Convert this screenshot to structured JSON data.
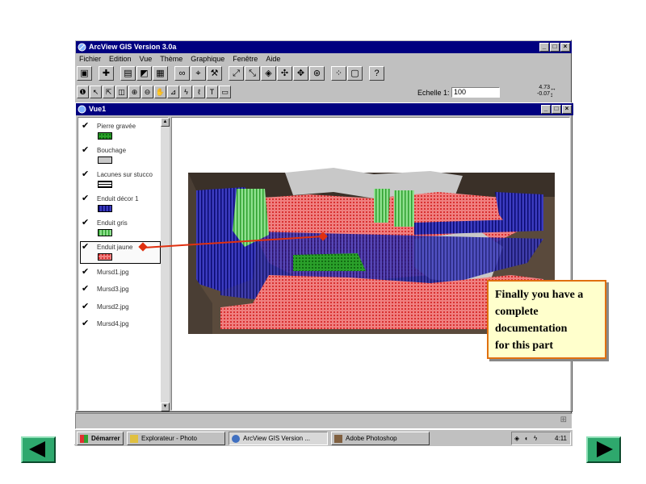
{
  "app": {
    "title": "ArcView GIS Version 3.0a",
    "menu": [
      "Fichier",
      "Edition",
      "Vue",
      "Thème",
      "Graphique",
      "Fenêtre",
      "Aide"
    ],
    "scale_label": "Echelle 1:",
    "scale_value": "100",
    "coords": [
      "4.73",
      "-0.07"
    ]
  },
  "view": {
    "title": "Vue1",
    "layers": [
      {
        "name": "Pierre gravée",
        "checked": true,
        "pattern": "green-dots"
      },
      {
        "name": "Bouchage",
        "checked": true,
        "pattern": "gray"
      },
      {
        "name": "Lacunes sur stucco",
        "checked": true,
        "pattern": "black-hlines"
      },
      {
        "name": "Enduit décor 1",
        "checked": true,
        "pattern": "blue-vlines"
      },
      {
        "name": "Enduit gris",
        "checked": true,
        "pattern": "green-vlines"
      },
      {
        "name": "Enduit jaune",
        "checked": true,
        "pattern": "red-dots",
        "selected": true
      },
      {
        "name": "Mursd1.jpg",
        "checked": true
      },
      {
        "name": "Mursd3.jpg",
        "checked": true
      },
      {
        "name": "Mursd2.jpg",
        "checked": true
      },
      {
        "name": "Mursd4.jpg",
        "checked": true
      }
    ]
  },
  "taskbar": {
    "start": "Démarrer",
    "tasks": [
      "Explorateur - Photo",
      "ArcView GIS Version ...",
      "Adobe Photoshop"
    ],
    "clock": "4:11"
  },
  "callout": {
    "lines": [
      "Finally you have a",
      "complete",
      "documentation",
      "for this part"
    ]
  },
  "colors": {
    "titlebar": "#000080",
    "window": "#c0c0c0",
    "callout_bg": "#ffffcc",
    "callout_border": "#e07010",
    "arrow": "#e03010",
    "nav": "#2ea86d"
  }
}
